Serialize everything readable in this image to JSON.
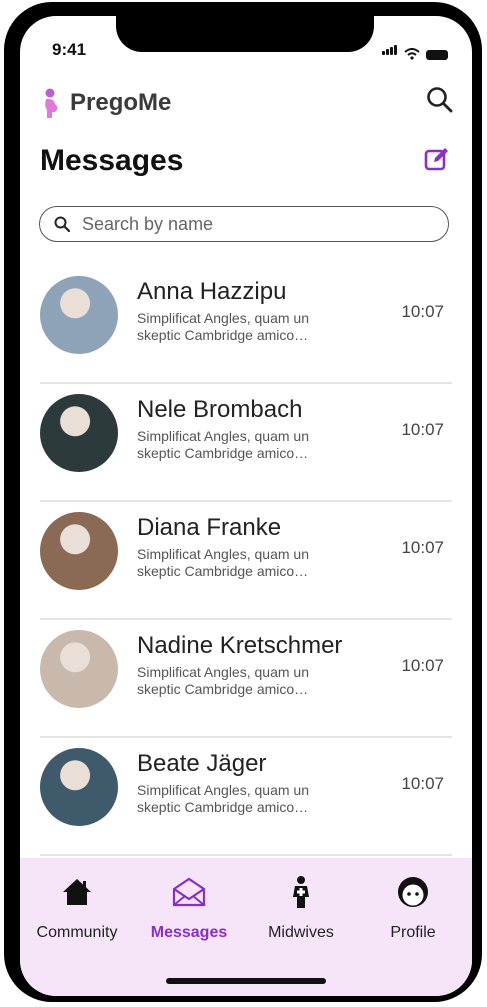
{
  "status": {
    "time": "9:41"
  },
  "app": {
    "name": "PregoMe"
  },
  "page": {
    "title": "Messages"
  },
  "search": {
    "placeholder": "Search by name"
  },
  "messages": [
    {
      "name": "Anna Hazzipu",
      "preview_line1": "Simplificat Angles, quam un",
      "preview_line2": "skeptic Cambridge amico…",
      "time": "10:07",
      "avatar_color": "#8fa3b8"
    },
    {
      "name": "Nele Brombach",
      "preview_line1": "Simplificat Angles, quam un",
      "preview_line2": "skeptic Cambridge amico…",
      "time": "10:07",
      "avatar_color": "#2d3a3c"
    },
    {
      "name": "Diana Franke",
      "preview_line1": "Simplificat Angles, quam un",
      "preview_line2": "skeptic Cambridge amico…",
      "time": "10:07",
      "avatar_color": "#8a6a55"
    },
    {
      "name": "Nadine Kretschmer",
      "preview_line1": "Simplificat Angles, quam un",
      "preview_line2": "skeptic Cambridge amico…",
      "time": "10:07",
      "avatar_color": "#c9b8ac"
    },
    {
      "name": "Beate Jäger",
      "preview_line1": "Simplificat Angles, quam un",
      "preview_line2": "skeptic Cambridge amico…",
      "time": "10:07",
      "avatar_color": "#3f5a6b"
    }
  ],
  "tabs": [
    {
      "label": "Community",
      "icon": "home-icon",
      "active": false
    },
    {
      "label": "Messages",
      "icon": "envelope-icon",
      "active": true
    },
    {
      "label": "Midwives",
      "icon": "midwife-icon",
      "active": false
    },
    {
      "label": "Profile",
      "icon": "baby-face-icon",
      "active": false
    }
  ],
  "colors": {
    "accent": "#8a2fc4",
    "tabbar_bg": "#f6e4f8",
    "divider": "#e4e4e4"
  }
}
